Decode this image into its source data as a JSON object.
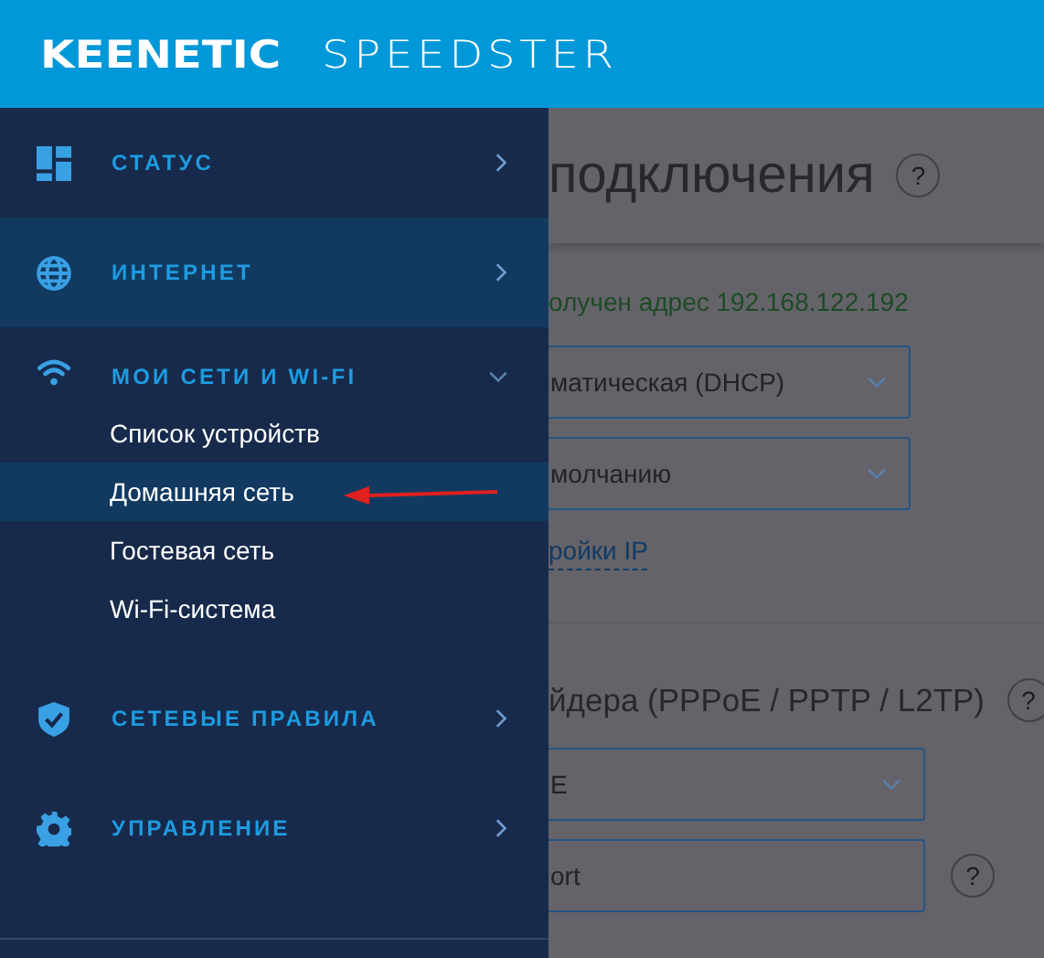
{
  "header": {
    "brand": "KEENETIC",
    "model": "SPEEDSTER"
  },
  "sidebar": {
    "items": [
      {
        "label": "СТАТУС",
        "selected": false,
        "expanded": false
      },
      {
        "label": "ИНТЕРНЕТ",
        "selected": true,
        "expanded": false
      },
      {
        "label": "МОИ СЕТИ И WI-FI",
        "selected": false,
        "expanded": true,
        "children": [
          {
            "label": "Список устройств",
            "selected": false
          },
          {
            "label": "Домашняя сеть",
            "selected": true
          },
          {
            "label": "Гостевая сеть",
            "selected": false
          },
          {
            "label": "Wi-Fi-система",
            "selected": false
          }
        ]
      },
      {
        "label": "СЕТЕВЫЕ ПРАВИЛА",
        "selected": false,
        "expanded": false
      },
      {
        "label": "УПРАВЛЕНИЕ",
        "selected": false,
        "expanded": false
      }
    ]
  },
  "content": {
    "title": "подключения",
    "title_help": "?",
    "status": "олучен адрес 192.168.122.192",
    "selects": [
      {
        "value": "матическая (DHCP)"
      },
      {
        "value": "молчанию"
      }
    ],
    "link": "ройки IP",
    "section_title": "йдера (PPPoE / PPTP / L2TP)",
    "section_help": "?",
    "fields": [
      {
        "kind": "select",
        "value": "E"
      },
      {
        "kind": "input",
        "value": "ort",
        "help": "?"
      }
    ]
  },
  "annotation": {
    "kind": "arrow"
  }
}
